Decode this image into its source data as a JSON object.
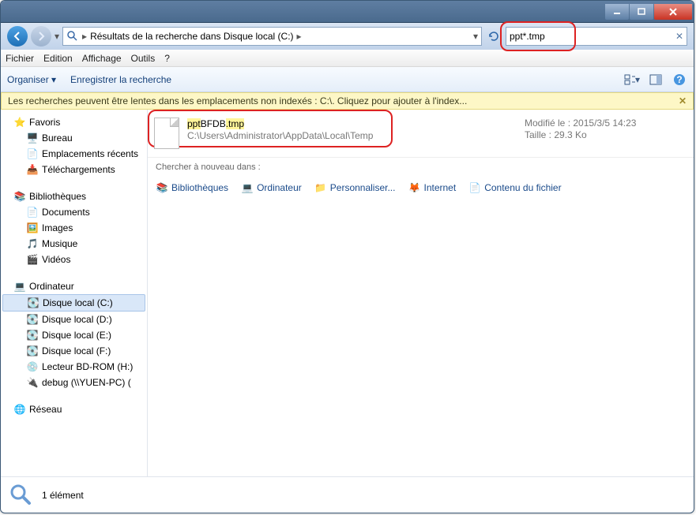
{
  "titlebar": {},
  "address": {
    "breadcrumb_label": "Résultats de la recherche dans Disque local (C:)",
    "search_value": "ppt*.tmp"
  },
  "menu": {
    "file": "Fichier",
    "edit": "Edition",
    "view": "Affichage",
    "tools": "Outils",
    "help": "?"
  },
  "toolbar": {
    "organize": "Organiser",
    "save_search": "Enregistrer la recherche"
  },
  "infobar": {
    "text": "Les recherches peuvent être lentes dans les emplacements non indexés : C:\\. Cliquez pour ajouter à l'index..."
  },
  "sidebar": {
    "favorites": {
      "label": "Favoris",
      "items": [
        "Bureau",
        "Emplacements récents",
        "Téléchargements"
      ]
    },
    "libraries": {
      "label": "Bibliothèques",
      "items": [
        "Documents",
        "Images",
        "Musique",
        "Vidéos"
      ]
    },
    "computer": {
      "label": "Ordinateur",
      "items": [
        "Disque local (C:)",
        "Disque local (D:)",
        "Disque local (E:)",
        "Disque local (F:)",
        "Lecteur BD-ROM (H:)",
        "debug (\\\\YUEN-PC) ("
      ]
    },
    "network": {
      "label": "Réseau"
    }
  },
  "result": {
    "name_prefix": "ppt",
    "name_mid": "BFDB",
    "name_suffix": ".tmp",
    "path": "C:\\Users\\Administrator\\AppData\\Local\\Temp",
    "modified_label": "Modifié le :",
    "modified_value": "2015/3/5 14:23",
    "size_label": "Taille :",
    "size_value": "29.3 Ko"
  },
  "searchagain": {
    "label": "Chercher à nouveau dans :",
    "items": [
      "Bibliothèques",
      "Ordinateur",
      "Personnaliser...",
      "Internet",
      "Contenu du fichier"
    ]
  },
  "status": {
    "count": "1 élément"
  }
}
